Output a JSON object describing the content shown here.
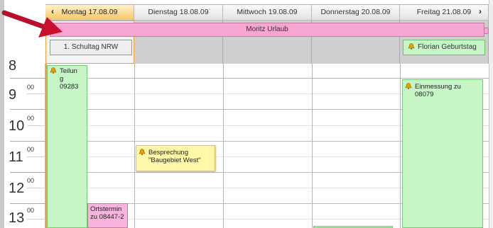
{
  "colors": {
    "today_header": "#f7c86a",
    "all_day_event": "#f7a6d2",
    "green_event": "#c6f5c6",
    "yellow_event": "#fff8a8",
    "pink_event": "#f8b4dc",
    "annotation_arrow": "#c8102e"
  },
  "nav": {
    "prev_icon": "‹",
    "next_icon": "›"
  },
  "days": [
    {
      "label": "Montag 17.08.09",
      "today": true
    },
    {
      "label": "Dienstag 18.08.09",
      "today": false
    },
    {
      "label": "Mittwoch 19.08.09",
      "today": false
    },
    {
      "label": "Donnerstag 20.08.09",
      "today": false
    },
    {
      "label": "Freitag 21.08.09",
      "today": false
    }
  ],
  "all_day": {
    "multi_day_event": "Moritz Urlaub",
    "monday_event": "1. Schultag NRW",
    "friday_event": "Florian Geburtstag"
  },
  "hours": [
    {
      "hour": "8",
      "min": ""
    },
    {
      "hour": "9",
      "min": "00"
    },
    {
      "hour": "10",
      "min": "00"
    },
    {
      "hour": "11",
      "min": "00"
    },
    {
      "hour": "12",
      "min": "00"
    },
    {
      "hour": "13",
      "min": "00"
    }
  ],
  "appointments": {
    "teilung": "Teilun g 09283",
    "ortstermin": "Ortstermin zu 08447-2",
    "besprechung": "Besprechung \"Baugebiet West\"",
    "einmessung": "Einmessung zu 08079"
  },
  "icons": {
    "reminder": "bell-icon",
    "annotation": "red-arrow-icon"
  }
}
